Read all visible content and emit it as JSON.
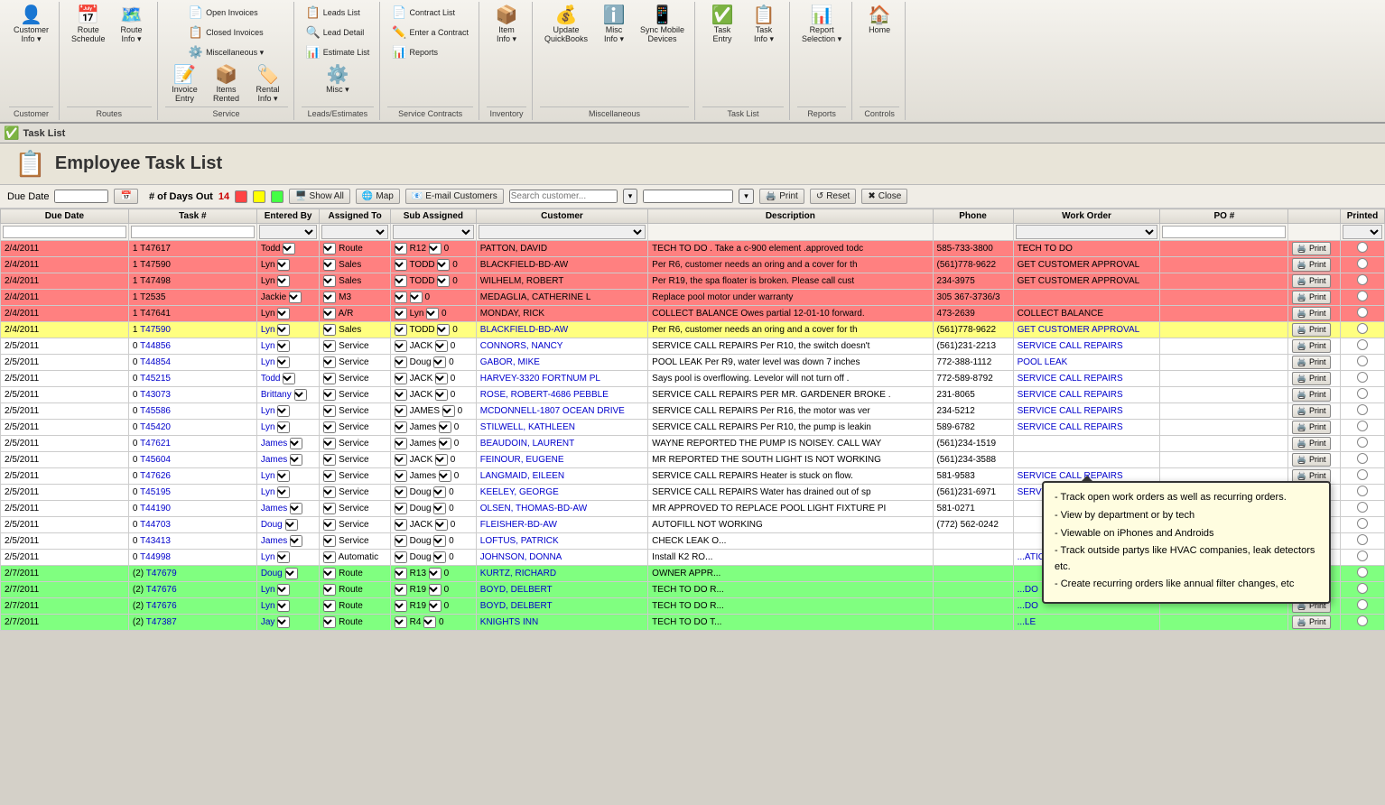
{
  "toolbar": {
    "groups": [
      {
        "label": "Customer",
        "buttons": [
          {
            "id": "customer-info",
            "icon": "👤",
            "label": "Customer\nInfo ▾",
            "dropdown": true
          }
        ]
      },
      {
        "label": "Routes",
        "buttons": [
          {
            "id": "route-schedule",
            "icon": "📅",
            "label": "Route\nSchedule"
          },
          {
            "id": "route-info",
            "icon": "🗺️",
            "label": "Route\nInfo ▾",
            "dropdown": true
          }
        ]
      },
      {
        "label": "Service",
        "buttons_top": [
          {
            "id": "open-invoices",
            "icon": "📄",
            "label": "Open Invoices"
          },
          {
            "id": "closed-invoices",
            "icon": "📋",
            "label": "Closed Invoices"
          },
          {
            "id": "miscellaneous",
            "icon": "⚙️",
            "label": "Miscellaneous ▾"
          }
        ],
        "buttons_bottom": [
          {
            "id": "invoice-entry",
            "icon": "📝",
            "label": "Invoice\nEntry"
          },
          {
            "id": "items-rented",
            "icon": "📦",
            "label": "Items\nRented"
          },
          {
            "id": "rental-info",
            "icon": "🏷️",
            "label": "Rental\nInfo ▾"
          }
        ]
      },
      {
        "label": "Leads/Estimates",
        "small_buttons": [
          {
            "id": "leads-list",
            "icon": "📋",
            "label": "Leads List"
          },
          {
            "id": "lead-detail",
            "icon": "🔍",
            "label": "Lead Detail"
          },
          {
            "id": "estimate-list",
            "icon": "📊",
            "label": "Estimate List"
          }
        ],
        "buttons": [
          {
            "id": "misc",
            "icon": "⚙️",
            "label": "Misc\n▾"
          }
        ]
      },
      {
        "label": "Service Contracts",
        "small_buttons": [
          {
            "id": "contract-list",
            "icon": "📄",
            "label": "Contract List"
          },
          {
            "id": "enter-contract",
            "icon": "✏️",
            "label": "Enter a Contract"
          },
          {
            "id": "reports-sc",
            "icon": "📊",
            "label": "Reports"
          }
        ]
      },
      {
        "label": "Inventory",
        "buttons": [
          {
            "id": "item-info",
            "icon": "📦",
            "label": "Item\nInfo ▾"
          }
        ]
      },
      {
        "label": "Miscellaneous",
        "buttons": [
          {
            "id": "update-quickbooks",
            "icon": "💰",
            "label": "Update\nQuickBooks"
          },
          {
            "id": "misc-info",
            "icon": "ℹ️",
            "label": "Misc\nInfo ▾"
          },
          {
            "id": "sync-mobile",
            "icon": "📱",
            "label": "Sync Mobile\nDevices"
          }
        ]
      },
      {
        "label": "Task List",
        "buttons": [
          {
            "id": "task-entry",
            "icon": "✅",
            "label": "Task\nEntry"
          },
          {
            "id": "task-info",
            "icon": "📋",
            "label": "Task\nInfo ▾"
          }
        ]
      },
      {
        "label": "Reports",
        "buttons": [
          {
            "id": "report-selection",
            "icon": "📊",
            "label": "Report\nSelection ▾"
          }
        ]
      },
      {
        "label": "Controls",
        "buttons": [
          {
            "id": "home",
            "icon": "🏠",
            "label": "Home"
          }
        ]
      }
    ]
  },
  "tab": {
    "icon": "✅",
    "label": "Task List"
  },
  "page": {
    "title": "Employee Task List",
    "icon": "📋"
  },
  "controls": {
    "days_out_label": "# of Days Out",
    "days_out_value": "14",
    "show_all": "Show All",
    "map": "Map",
    "email_customers": "E-mail Customers",
    "print": "Print",
    "reset": "Reset",
    "close": "Close"
  },
  "table": {
    "columns": [
      "Due Date",
      "Task #",
      "Entered By",
      "Assigned To",
      "Sub Assigned",
      "Customer",
      "",
      "",
      "",
      "# of Days Out",
      "",
      "Show All",
      "Map",
      "E-mail Customers",
      "Print",
      "Reset",
      "Close",
      "PO #",
      "Printed"
    ],
    "headers": [
      "Due Date",
      "Task #",
      "Entered By",
      "Assigned To",
      "Sub Assigned",
      "Customer",
      "Description",
      "Phone",
      "Work Order",
      "PO #",
      "Printed"
    ],
    "rows": [
      {
        "date": "2/4/2011",
        "priority": "1",
        "task": "T47617",
        "entered": "Todd",
        "assigned": "Route",
        "sub": "R12",
        "sub2": "0",
        "customer": "PATTON, DAVID",
        "desc": "TECH TO DO . Take a c-900 element .approved todc",
        "phone": "585-733-3800",
        "workorder": "TECH TO DO",
        "po": "",
        "printed": false,
        "color": "red"
      },
      {
        "date": "2/4/2011",
        "priority": "1",
        "task": "T47590",
        "entered": "Lyn",
        "assigned": "Sales",
        "sub": "TODD",
        "sub2": "0",
        "customer": "BLACKFIELD-BD-AW",
        "desc": "Per R6, customer needs an oring and a cover for th",
        "phone": "(561)778-9622",
        "workorder": "GET CUSTOMER APPROVAL",
        "po": "",
        "printed": false,
        "color": "red"
      },
      {
        "date": "2/4/2011",
        "priority": "1",
        "task": "T47498",
        "entered": "Lyn",
        "assigned": "Sales",
        "sub": "TODD",
        "sub2": "0",
        "customer": "WILHELM, ROBERT",
        "desc": "Per R19, the spa floater is broken.  Please call cust",
        "phone": "234-3975",
        "workorder": "GET CUSTOMER APPROVAL",
        "po": "",
        "printed": false,
        "color": "red"
      },
      {
        "date": "2/4/2011",
        "priority": "1",
        "task": "T2535",
        "entered": "Jackie",
        "assigned": "M3",
        "sub": "",
        "sub2": "0",
        "customer": "MEDAGLIA, CATHERINE L",
        "desc": "Replace pool motor under warranty",
        "phone": "305 367-3736/3",
        "workorder": "",
        "po": "",
        "printed": false,
        "color": "red"
      },
      {
        "date": "2/4/2011",
        "priority": "1",
        "task": "T47641",
        "entered": "Lyn",
        "assigned": "A/R",
        "sub": "Lyn",
        "sub2": "0",
        "customer": "MONDAY, RICK",
        "desc": "COLLECT BALANCE  Owes partial 12-01-10 forward.",
        "phone": "473-2639",
        "workorder": "COLLECT BALANCE",
        "po": "",
        "printed": false,
        "color": "red"
      },
      {
        "date": "2/4/2011",
        "priority": "1",
        "task": "T47590",
        "entered": "Lyn",
        "assigned": "Sales",
        "sub": "TODD",
        "sub2": "0",
        "customer": "BLACKFIELD-BD-AW",
        "desc": "Per R6, customer needs an oring and a cover for th",
        "phone": "(561)778-9622",
        "workorder": "GET CUSTOMER APPROVAL",
        "po": "",
        "printed": false,
        "color": "yellow"
      },
      {
        "date": "2/5/2011",
        "priority": "0",
        "task": "T44856",
        "entered": "Lyn",
        "assigned": "Service",
        "sub": "JACK",
        "sub2": "0",
        "customer": "CONNORS, NANCY",
        "desc": "SERVICE CALL REPAIRS  Per R10, the switch doesn't",
        "phone": "(561)231-2213",
        "workorder": "SERVICE CALL REPAIRS",
        "po": "",
        "printed": false,
        "color": "white"
      },
      {
        "date": "2/5/2011",
        "priority": "0",
        "task": "T44854",
        "entered": "Lyn",
        "assigned": "Service",
        "sub": "Doug",
        "sub2": "0",
        "customer": "GABOR, MIKE",
        "desc": "POOL LEAK  Per R9, water level was down 7 inches",
        "phone": "772-388-1112",
        "workorder": "POOL LEAK",
        "po": "",
        "printed": false,
        "color": "white"
      },
      {
        "date": "2/5/2011",
        "priority": "0",
        "task": "T45215",
        "entered": "Todd",
        "assigned": "Service",
        "sub": "JACK",
        "sub2": "0",
        "customer": "HARVEY-3320 FORTNUM PL",
        "desc": "Says pool is overflowing. Levelor will not turn off .",
        "phone": "772-589-8792",
        "workorder": "SERVICE CALL REPAIRS",
        "po": "",
        "printed": false,
        "color": "white"
      },
      {
        "date": "2/5/2011",
        "priority": "0",
        "task": "T43073",
        "entered": "Brittany",
        "assigned": "Service",
        "sub": "JACK",
        "sub2": "0",
        "customer": "ROSE, ROBERT-4686 PEBBLE",
        "desc": "SERVICE CALL REPAIRS PER MR. GARDENER BROKE .",
        "phone": "231-8065",
        "workorder": "SERVICE CALL REPAIRS",
        "po": "",
        "printed": false,
        "color": "white"
      },
      {
        "date": "2/5/2011",
        "priority": "0",
        "task": "T45586",
        "entered": "Lyn",
        "assigned": "Service",
        "sub": "JAMES",
        "sub2": "0",
        "customer": "MCDONNELL-1807 OCEAN DRIVE",
        "desc": "SERVICE CALL REPAIRS  Per R16, the motor was ver",
        "phone": "234-5212",
        "workorder": "SERVICE CALL REPAIRS",
        "po": "",
        "printed": false,
        "color": "white"
      },
      {
        "date": "2/5/2011",
        "priority": "0",
        "task": "T45420",
        "entered": "Lyn",
        "assigned": "Service",
        "sub": "James",
        "sub2": "0",
        "customer": "STILWELL, KATHLEEN",
        "desc": "SERVICE CALL REPAIRS  Per R10, the pump is leakin",
        "phone": "589-6782",
        "workorder": "SERVICE CALL REPAIRS",
        "po": "",
        "printed": false,
        "color": "white"
      },
      {
        "date": "2/5/2011",
        "priority": "0",
        "task": "T47621",
        "entered": "James",
        "assigned": "Service",
        "sub": "James",
        "sub2": "0",
        "customer": "BEAUDOIN, LAURENT",
        "desc": "WAYNE REPORTED THE PUMP IS NOISEY. CALL WAY",
        "phone": "(561)234-1519",
        "workorder": "",
        "po": "",
        "printed": false,
        "color": "white"
      },
      {
        "date": "2/5/2011",
        "priority": "0",
        "task": "T45604",
        "entered": "James",
        "assigned": "Service",
        "sub": "JACK",
        "sub2": "0",
        "customer": "FEINOUR, EUGENE",
        "desc": "MR REPORTED THE SOUTH LIGHT IS NOT WORKING",
        "phone": "(561)234-3588",
        "workorder": "",
        "po": "",
        "printed": false,
        "color": "white"
      },
      {
        "date": "2/5/2011",
        "priority": "0",
        "task": "T47626",
        "entered": "Lyn",
        "assigned": "Service",
        "sub": "James",
        "sub2": "0",
        "customer": "LANGMAID, EILEEN",
        "desc": "SERVICE CALL REPAIRS  Heater is stuck on flow.",
        "phone": "581-9583",
        "workorder": "SERVICE CALL REPAIRS",
        "po": "",
        "printed": false,
        "color": "white"
      },
      {
        "date": "2/5/2011",
        "priority": "0",
        "task": "T45195",
        "entered": "Lyn",
        "assigned": "Service",
        "sub": "Doug",
        "sub2": "0",
        "customer": "KEELEY, GEORGE",
        "desc": "SERVICE CALL REPAIRS  Water has drained out of sp",
        "phone": "(561)231-6971",
        "workorder": "SERVICE CALL REPAIRS",
        "po": "",
        "printed": false,
        "color": "white"
      },
      {
        "date": "2/5/2011",
        "priority": "0",
        "task": "T44190",
        "entered": "James",
        "assigned": "Service",
        "sub": "Doug",
        "sub2": "0",
        "customer": "OLSEN, THOMAS-BD-AW",
        "desc": "MR APPROVED TO REPLACE POOL LIGHT FIXTURE PI",
        "phone": "581-0271",
        "workorder": "",
        "po": "",
        "printed": false,
        "color": "white"
      },
      {
        "date": "2/5/2011",
        "priority": "0",
        "task": "T44703",
        "entered": "Doug",
        "assigned": "Service",
        "sub": "JACK",
        "sub2": "0",
        "customer": "FLEISHER-BD-AW",
        "desc": "AUTOFILL NOT WORKING",
        "phone": "(772) 562-0242",
        "workorder": "",
        "po": "",
        "printed": false,
        "color": "white"
      },
      {
        "date": "2/5/2011",
        "priority": "0",
        "task": "T43413",
        "entered": "James",
        "assigned": "Service",
        "sub": "Doug",
        "sub2": "0",
        "customer": "LOFTUS, PATRICK",
        "desc": "CHECK LEAK O...",
        "phone": "",
        "workorder": "",
        "po": "",
        "printed": false,
        "color": "white"
      },
      {
        "date": "2/5/2011",
        "priority": "0",
        "task": "T44998",
        "entered": "Lyn",
        "assigned": "Automatic",
        "sub": "Doug",
        "sub2": "0",
        "customer": "JOHNSON, DONNA",
        "desc": "Install K2 RO...",
        "phone": "",
        "workorder": "...ATION",
        "po": "",
        "printed": false,
        "color": "white"
      },
      {
        "date": "2/7/2011",
        "priority": "(2)",
        "task": "T47679",
        "entered": "Doug",
        "assigned": "Route",
        "sub": "R13",
        "sub2": "0",
        "customer": "KURTZ, RICHARD",
        "desc": "OWNER APPR...",
        "phone": "",
        "workorder": "",
        "po": "",
        "printed": false,
        "color": "green"
      },
      {
        "date": "2/7/2011",
        "priority": "(2)",
        "task": "T47676",
        "entered": "Lyn",
        "assigned": "Route",
        "sub": "R19",
        "sub2": "0",
        "customer": "BOYD, DELBERT",
        "desc": "TECH TO DO R...",
        "phone": "",
        "workorder": "...DO",
        "po": "",
        "printed": false,
        "color": "green"
      },
      {
        "date": "2/7/2011",
        "priority": "(2)",
        "task": "T47676",
        "entered": "Lyn",
        "assigned": "Route",
        "sub": "R19",
        "sub2": "0",
        "customer": "BOYD, DELBERT",
        "desc": "TECH TO DO R...",
        "phone": "",
        "workorder": "...DO",
        "po": "",
        "printed": false,
        "color": "green"
      },
      {
        "date": "2/7/2011",
        "priority": "(2)",
        "task": "T47387",
        "entered": "Jay",
        "assigned": "Route",
        "sub": "R4",
        "sub2": "0",
        "customer": "KNIGHTS INN",
        "desc": "TECH TO DO T...",
        "phone": "",
        "workorder": "...LE",
        "po": "",
        "printed": false,
        "color": "green"
      }
    ]
  },
  "callout": {
    "bullets": [
      "Track open work orders as well as recurring orders.",
      "View by department or by tech",
      "Viewable on iPhones and Androids",
      "Track outside partys like HVAC companies, leak detectors etc.",
      "Create recurring orders like annual filter changes, etc"
    ]
  }
}
